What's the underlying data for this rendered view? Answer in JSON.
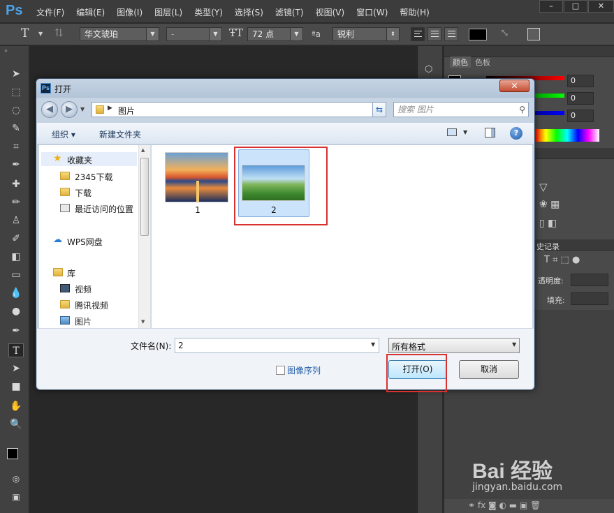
{
  "app": {
    "logo": "Ps",
    "menu": [
      "文件(F)",
      "编辑(E)",
      "图像(I)",
      "图层(L)",
      "类型(Y)",
      "选择(S)",
      "滤镜(T)",
      "视图(V)",
      "窗口(W)",
      "帮助(H)"
    ],
    "window_buttons": [
      "–",
      "□",
      "✕"
    ]
  },
  "options_bar": {
    "font_family": "华文琥珀",
    "font_style": "-",
    "font_size": "72 点",
    "aa_glyph": "ªa",
    "anti_alias": "锐利",
    "text_color": "#000000"
  },
  "panels": {
    "tabs": [
      "颜色",
      "色板"
    ],
    "color_values": [
      "0",
      "0",
      "0"
    ],
    "history_tab": "史记录",
    "opacity_label": "透明度:",
    "fill_label": "填充:"
  },
  "dialog": {
    "title": "打开",
    "close": "✕",
    "address": "图片",
    "search_placeholder": "搜索 图片",
    "organize": "组织 ▾",
    "new_folder": "新建文件夹",
    "nav_items": {
      "favorites": "收藏夹",
      "fav_2345": "2345下载",
      "fav_download": "下载",
      "fav_recent": "最近访问的位置",
      "wps": "WPS网盘",
      "library": "库",
      "lib_video": "视频",
      "lib_tencent": "腾讯视频",
      "lib_pictures": "图片"
    },
    "files": [
      {
        "name": "1",
        "selected": false
      },
      {
        "name": "2",
        "selected": true
      }
    ],
    "filename_label": "文件名(N):",
    "filename_value": "2",
    "filetype_value": "所有格式",
    "sequence_label": "图像序列",
    "open_button": "打开(O)",
    "cancel_button": "取消"
  },
  "watermark": {
    "text": "Bai 经验",
    "url": "jingyan.baidu.com"
  },
  "colors": {
    "ps_dark": "#2b2b2b",
    "ps_panel": "#4a4a4a",
    "dialog_frame": "#c7d4e3",
    "highlight_red": "#d93030",
    "selection_blue": "#cce4fb"
  }
}
